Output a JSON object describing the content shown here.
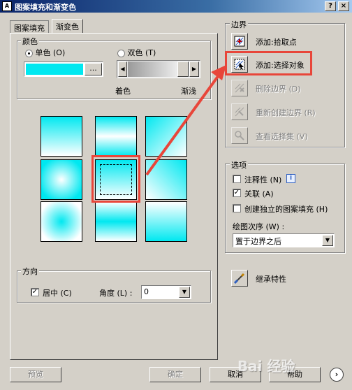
{
  "window": {
    "title": "图案填充和渐变色",
    "app_icon": "A",
    "help_btn": "?",
    "close_btn": "×"
  },
  "tabs": [
    {
      "label": "图案填充"
    },
    {
      "label": "渐变色"
    }
  ],
  "color": {
    "group_label": "颜色",
    "one_color_label": "单色",
    "one_color_key": "(O)",
    "two_color_label": "双色",
    "two_color_key": "(T)",
    "color_value": "#00e8f0",
    "browse_label": "...",
    "shade_label": "着色",
    "tint_label": "渐浅"
  },
  "orientation": {
    "group_label": "方向",
    "centered_label": "居中",
    "centered_key": "(C)",
    "centered_checked": true,
    "angle_label": "角度",
    "angle_key": "(L)",
    "angle_colon": ":",
    "angle_value": "0"
  },
  "boundaries": {
    "group_label": "边界",
    "pick_points": "添加:拾取点",
    "select_objects": "添加:选择对象",
    "remove": "删除边界",
    "remove_key": "(D)",
    "recreate": "重新创建边界",
    "recreate_key": "(R)",
    "view": "查看选择集",
    "view_key": "(V)"
  },
  "options": {
    "group_label": "选项",
    "annotative": "注释性",
    "annotative_key": "(N)",
    "info_icon": "i",
    "annotative_checked": false,
    "associative": "关联",
    "associative_key": "(A)",
    "associative_checked": true,
    "separate": "创建独立的图案填充",
    "separate_key": "(H)",
    "separate_checked": false,
    "draw_order_label": "绘图次序",
    "draw_order_key": "(W)",
    "draw_order_colon": ":",
    "draw_order_value": "置于边界之后"
  },
  "inherit": {
    "label": "继承特性"
  },
  "footer": {
    "preview": "预览",
    "ok": "确定",
    "cancel": "取消",
    "help": "帮助"
  },
  "watermark": {
    "text": "Bai 经验"
  },
  "colors": {
    "accent_red": "#e8463a",
    "title_blue": "#0a246a",
    "cyan": "#00e8f0"
  }
}
